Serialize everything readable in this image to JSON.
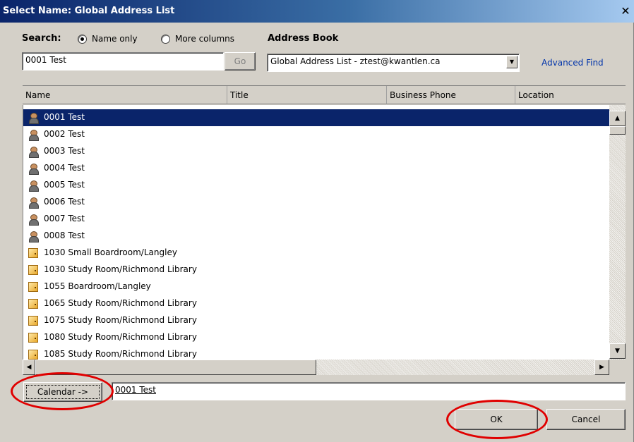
{
  "window": {
    "title": "Select Name: Global Address List",
    "close_glyph": "✕"
  },
  "search": {
    "label": "Search:",
    "option_name_only": "Name only",
    "option_more_columns": "More columns",
    "selected_option": "Name only",
    "value": "0001 Test",
    "go_label": "Go"
  },
  "address_book": {
    "label": "Address Book",
    "selected": "Global Address List - ztest@kwantlen.ca",
    "advanced_find": "Advanced Find"
  },
  "columns": [
    "Name",
    "Title",
    "Business Phone",
    "Location"
  ],
  "rows": [
    {
      "name": "0001 Test",
      "icon": "person-icon",
      "selected": true
    },
    {
      "name": "0002 Test",
      "icon": "person-icon"
    },
    {
      "name": "0003 Test",
      "icon": "person-icon"
    },
    {
      "name": "0004 Test",
      "icon": "person-icon"
    },
    {
      "name": "0005 Test",
      "icon": "person-icon"
    },
    {
      "name": "0006 Test",
      "icon": "person-icon"
    },
    {
      "name": "0007 Test",
      "icon": "person-icon"
    },
    {
      "name": "0008 Test",
      "icon": "person-icon"
    },
    {
      "name": "1030 Small Boardroom/Langley",
      "icon": "room-icon"
    },
    {
      "name": "1030 Study Room/Richmond Library",
      "icon": "room-icon"
    },
    {
      "name": "1055 Boardroom/Langley",
      "icon": "room-icon"
    },
    {
      "name": "1065 Study Room/Richmond Library",
      "icon": "room-icon"
    },
    {
      "name": "1075 Study Room/Richmond Library",
      "icon": "room-icon"
    },
    {
      "name": "1080 Study Room/Richmond Library",
      "icon": "room-icon"
    },
    {
      "name": "1085 Study Room/Richmond Library",
      "icon": "room-icon"
    }
  ],
  "calendar": {
    "button_label": "Calendar ->",
    "value": "0001 Test"
  },
  "footer": {
    "ok_label": "OK",
    "cancel_label": "Cancel"
  },
  "colors": {
    "selection": "#0a246a",
    "highlight_mark": "#e00000",
    "link": "#0033aa"
  }
}
